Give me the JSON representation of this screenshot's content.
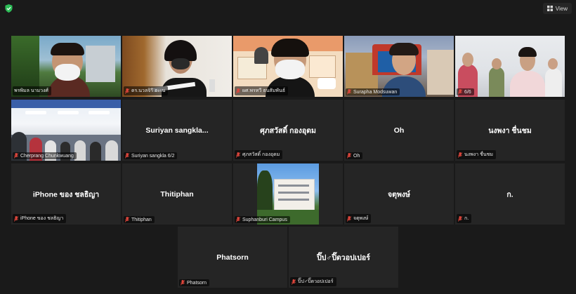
{
  "topbar": {
    "view_label": "View",
    "shield_color": "#2dbd58"
  },
  "participants": [
    {
      "name": "พรพิมล นามวงศ์",
      "display": ""
    },
    {
      "name": "ดร.นวลจิรี ฮะเน",
      "display": ""
    },
    {
      "name": "ผศ.พรทวี ธนสัมพันธ์",
      "display": ""
    },
    {
      "name": "Surapha Modsuwan",
      "display": ""
    },
    {
      "name": "6/6",
      "display": ""
    },
    {
      "name": "Cherprang Chunkwuang",
      "display": ""
    },
    {
      "name": "Suriyan sangkla 6/2",
      "display": "Suriyan sangkla..."
    },
    {
      "name": "ศุภสวัสดิ์ กองอุดม",
      "display": "ศุภสวัสดิ์ กองอุดม"
    },
    {
      "name": "Oh",
      "display": "Oh"
    },
    {
      "name": "นงพงา ชื่นชม",
      "display": "นงพงา ชื่นชม"
    },
    {
      "name": "iPhone ของ ชลธิญา",
      "display": "iPhone ของ ชลธิญา"
    },
    {
      "name": "Thitiphan",
      "display": "Thitiphan"
    },
    {
      "name": "Suphanburi Campus",
      "display": ""
    },
    {
      "name": "จตุพงษ์",
      "display": "จตุพงษ์"
    },
    {
      "name": "ก.",
      "display": "ก."
    },
    {
      "name": "Phatsorn",
      "display": "Phatsorn"
    },
    {
      "name": "ปิ๊ป♂ปิ๊ดวอปเปอร์",
      "display": "ปิ๊ป♂ปิ๊ดวอปเปอร์"
    }
  ],
  "colors": {
    "active_speaker": "#d4e157",
    "mic_muted": "#e0463c",
    "tile_bg": "#252525"
  }
}
